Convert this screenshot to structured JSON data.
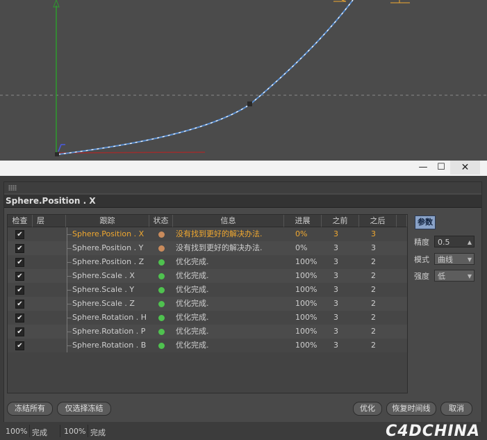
{
  "window": {
    "minimize_label": "—",
    "maximize_label": "☐",
    "close_label": "✕"
  },
  "panel": {
    "title": "Sphere.Position . X"
  },
  "table": {
    "headers": {
      "check": "检查",
      "layer": "层",
      "track": "跟踪",
      "state": "状态",
      "info": "信息",
      "progress": "进展",
      "before": "之前",
      "after": "之后"
    },
    "rows": [
      {
        "track": "Sphere.Position . X",
        "info": "没有找到更好的解决办法.",
        "progress": "0%",
        "before": "3",
        "after": "3",
        "state_color": "#c98b5c",
        "highlight": true
      },
      {
        "track": "Sphere.Position . Y",
        "info": "没有找到更好的解决办法.",
        "progress": "0%",
        "before": "3",
        "after": "3",
        "state_color": "#c98b5c",
        "highlight": false
      },
      {
        "track": "Sphere.Position . Z",
        "info": "优化完成.",
        "progress": "100%",
        "before": "3",
        "after": "2",
        "state_color": "#4fc24f",
        "highlight": false
      },
      {
        "track": "Sphere.Scale . X",
        "info": "优化完成.",
        "progress": "100%",
        "before": "3",
        "after": "2",
        "state_color": "#4fc24f",
        "highlight": false
      },
      {
        "track": "Sphere.Scale . Y",
        "info": "优化完成.",
        "progress": "100%",
        "before": "3",
        "after": "2",
        "state_color": "#4fc24f",
        "highlight": false
      },
      {
        "track": "Sphere.Scale . Z",
        "info": "优化完成.",
        "progress": "100%",
        "before": "3",
        "after": "2",
        "state_color": "#4fc24f",
        "highlight": false
      },
      {
        "track": "Sphere.Rotation . H",
        "info": "优化完成.",
        "progress": "100%",
        "before": "3",
        "after": "2",
        "state_color": "#4fc24f",
        "highlight": false
      },
      {
        "track": "Sphere.Rotation . P",
        "info": "优化完成.",
        "progress": "100%",
        "before": "3",
        "after": "2",
        "state_color": "#4fc24f",
        "highlight": false
      },
      {
        "track": "Sphere.Rotation . B",
        "info": "优化完成.",
        "progress": "100%",
        "before": "3",
        "after": "2",
        "state_color": "#4fc24f",
        "highlight": false
      }
    ]
  },
  "params": {
    "tab_label": "参数",
    "precision_label": "精度",
    "precision_value": "0.5",
    "mode_label": "模式",
    "mode_value": "曲线",
    "strength_label": "强度",
    "strength_value": "低"
  },
  "buttons": {
    "freeze_all": "冻结所有",
    "freeze_selected": "仅选择冻结",
    "optimize": "优化",
    "restore_timeline": "恢复时间线",
    "cancel": "取消"
  },
  "status": {
    "pct1": "100%",
    "done1": "完成",
    "pct2": "100%",
    "done2": "完成"
  },
  "watermark": "C4DCHINA",
  "colors": {
    "highlight": "#f0a830",
    "warn_dot": "#c98b5c",
    "ok_dot": "#4fc24f",
    "tab_active": "#8aa3c8"
  }
}
